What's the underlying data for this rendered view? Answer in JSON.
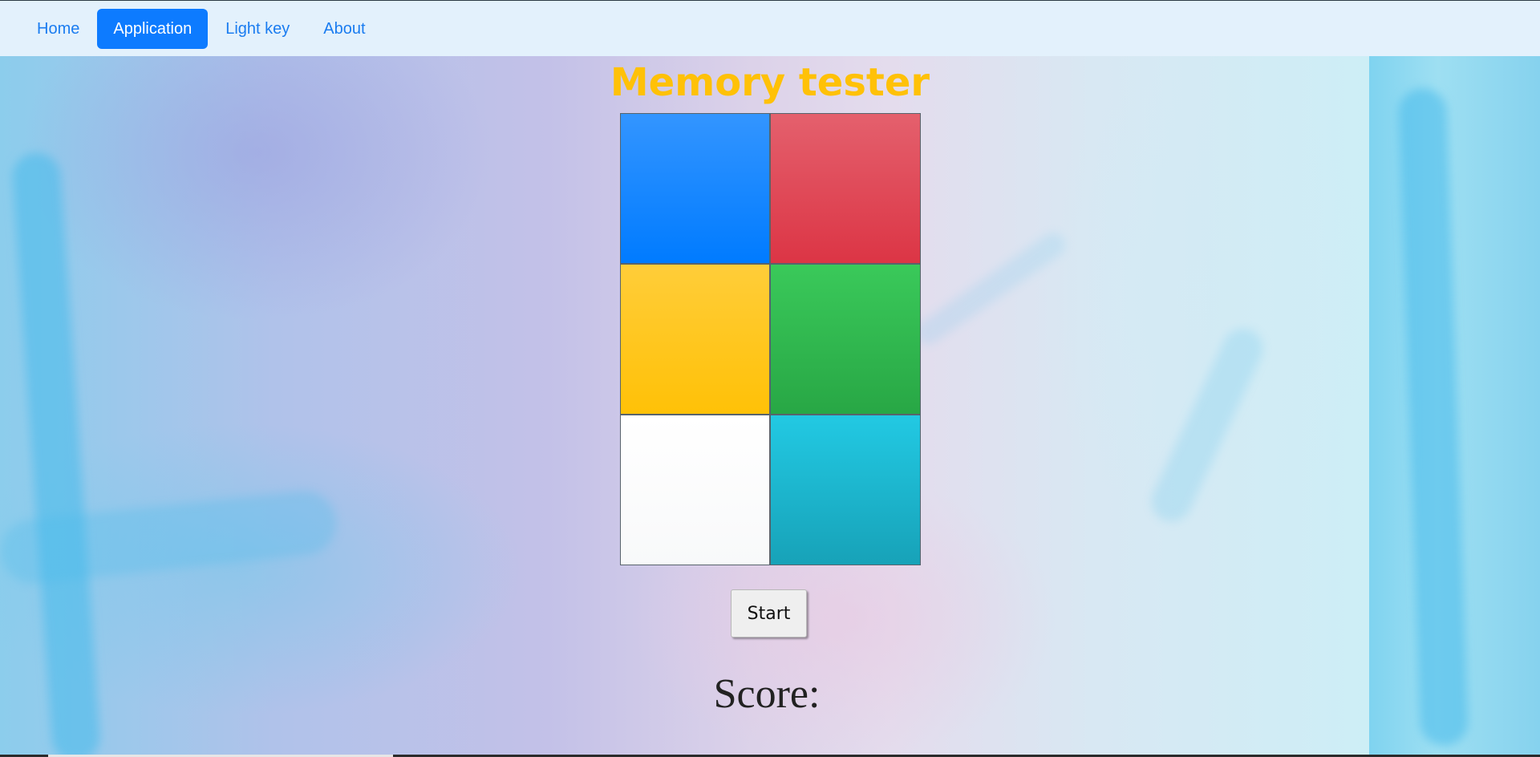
{
  "nav": {
    "items": [
      {
        "label": "Home",
        "active": false
      },
      {
        "label": "Application",
        "active": true
      },
      {
        "label": "Light key",
        "active": false
      },
      {
        "label": "About",
        "active": false
      }
    ]
  },
  "game": {
    "title": "Memory tester",
    "tiles": [
      {
        "color_name": "blue",
        "color": "#007bff"
      },
      {
        "color_name": "red",
        "color": "#dc3545"
      },
      {
        "color_name": "yellow",
        "color": "#ffc107"
      },
      {
        "color_name": "green",
        "color": "#28a745"
      },
      {
        "color_name": "white",
        "color": "#f8f9fa"
      },
      {
        "color_name": "cyan",
        "color": "#17a2b8"
      }
    ],
    "start_label": "Start",
    "score_label": "Score:",
    "score_value": ""
  },
  "colors": {
    "nav_background": "#e3f1fc",
    "nav_link": "#1a7cf0",
    "nav_active_background": "#0d7bff",
    "title": "#ffc107"
  }
}
